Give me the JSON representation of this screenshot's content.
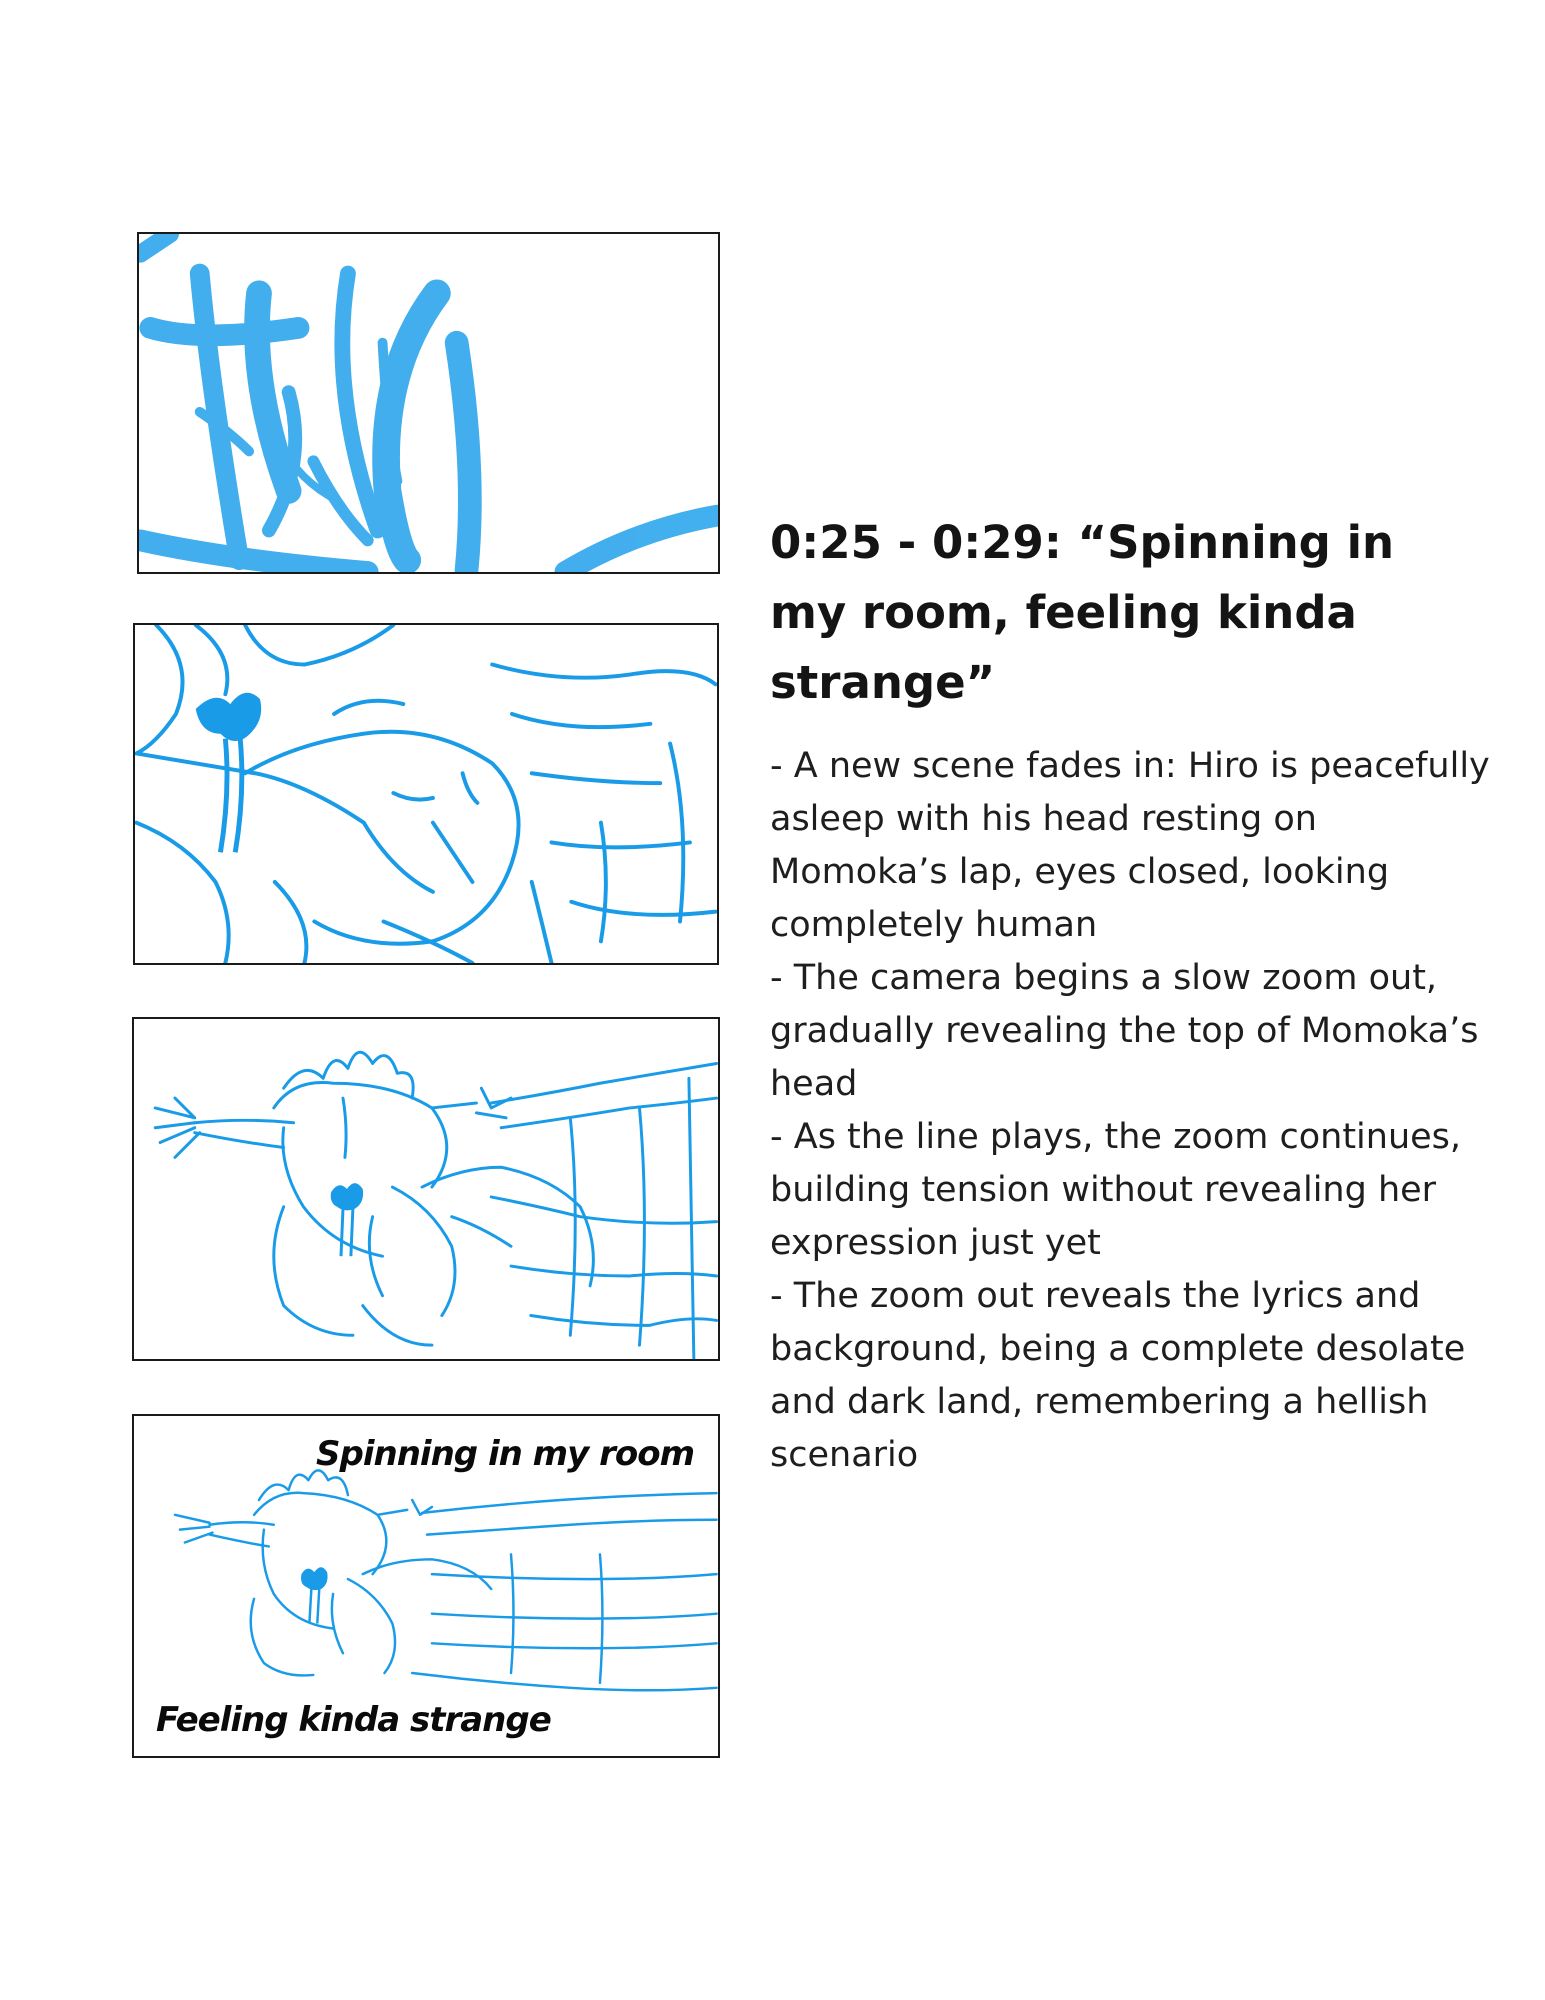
{
  "storyboard": {
    "heading": "0:25 - 0:29: “Spinning in my room, feeling kinda strange”",
    "notes": [
      "- A new scene fades in: Hiro is peacefully asleep with his head resting on Momoka’s lap, eyes closed, looking completely human",
      "- The camera begins a slow zoom out, gradually revealing the top of Momoka’s head",
      "- As the line plays, the zoom continues, building tension without revealing her expression just yet",
      "- The zoom out reveals the lyrics and background, being a complete desolate and dark land, remembering a hellish scenario"
    ],
    "panel_4_lyrics": {
      "top": "Spinning in my room",
      "bottom": "Feeling kinda strange"
    }
  },
  "colors": {
    "sketch": "#1a9be8",
    "border": "#1a1a1a",
    "text": "#141414"
  }
}
